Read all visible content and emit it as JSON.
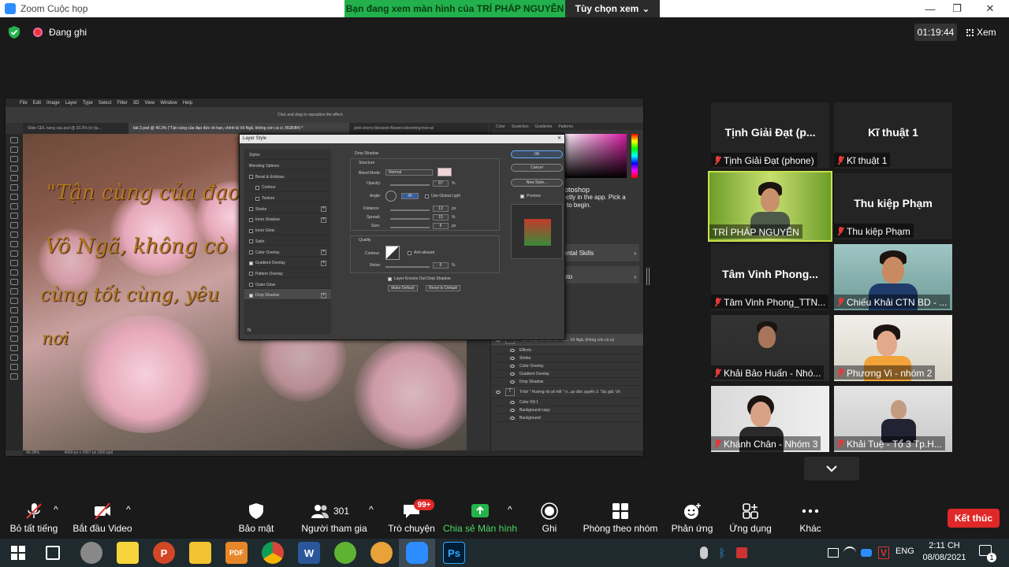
{
  "window": {
    "title": "Zoom Cuộc họp",
    "share_banner": "Bạn đang xem màn hình của TRÍ PHÁP NGUYỄN",
    "view_options": "Tùy chọn xem",
    "view_options_caret": "⌄",
    "minimize": "—",
    "maximize": "❐",
    "close": "✕"
  },
  "top": {
    "recording": "Đang ghi",
    "timer": "01:19:44",
    "view": "Xem"
  },
  "photoshop": {
    "menu": [
      "File",
      "Edit",
      "Image",
      "Layer",
      "Type",
      "Select",
      "Filter",
      "3D",
      "View",
      "Window",
      "Help"
    ],
    "options_hint": "Click and drag to reposition the effect.",
    "tabs": [
      "Slide CĐL nang cao.psd @ 33.3% (vi dụ...",
      "bài 2.psd @ 40.3% (\"Tận cùng của đạo đức vô hạn, chính là  Vô Ngã, không còn cá cì, RGB/8#) *",
      "pink-cherry-blossom-flowers-blooming-tree-wi"
    ],
    "canvas_text": [
      "\"Tận cùng của đạo",
      "Vô Ngã, không cò",
      "cùng tốt cùng, yêu",
      "nơi"
    ],
    "status": [
      "40.28%",
      "4000 px x 2667 px (300 ppi)"
    ],
    "panel_right": {
      "get_started": "hotoshop",
      "desc1": "rectly in the app. Pick a",
      "desc2": "w to begin.",
      "skills": "ental Skills",
      "photo": "oto",
      "panel_tabs": [
        "Color",
        "Swatches",
        "Gradients",
        "Patterns"
      ]
    },
    "layers": [
      {
        "name": "\"Tận cùng của đạo đức vô... Vô Ngã, không còn cá cà",
        "icon": "T"
      },
      {
        "name": "Effects",
        "icon": ""
      },
      {
        "name": "Stroke",
        "icon": ""
      },
      {
        "name": "Color Overlay",
        "icon": ""
      },
      {
        "name": "Gradient Overlay",
        "icon": ""
      },
      {
        "name": "Drop Shadow",
        "icon": ""
      },
      {
        "name": "Trích \" Hướng rồi sẽ hết \" n...ạo đức quyển 3. Tác giả: Vô",
        "icon": "T"
      },
      {
        "name": "Color Fill 1",
        "icon": ""
      },
      {
        "name": "Background copy",
        "icon": ""
      },
      {
        "name": "Background",
        "icon": ""
      }
    ],
    "dialog": {
      "title": "Layer Style",
      "close": "✕",
      "styles": [
        {
          "label": "Styles",
          "check": null,
          "plus": false
        },
        {
          "label": "Blending Options",
          "check": null,
          "plus": false
        },
        {
          "label": "Bevel & Emboss",
          "check": false,
          "plus": false
        },
        {
          "label": "Contour",
          "check": false,
          "plus": false
        },
        {
          "label": "Texture",
          "check": false,
          "plus": false
        },
        {
          "label": "Stroke",
          "check": false,
          "plus": true
        },
        {
          "label": "Inner Shadow",
          "check": false,
          "plus": true
        },
        {
          "label": "Inner Glow",
          "check": false,
          "plus": false
        },
        {
          "label": "Satin",
          "check": false,
          "plus": false
        },
        {
          "label": "Color Overlay",
          "check": false,
          "plus": true
        },
        {
          "label": "Gradient Overlay",
          "check": true,
          "plus": true
        },
        {
          "label": "Pattern Overlay",
          "check": false,
          "plus": false
        },
        {
          "label": "Outer Glow",
          "check": false,
          "plus": false
        },
        {
          "label": "Drop Shadow",
          "check": true,
          "plus": true
        }
      ],
      "fx_label": "fx",
      "section": "Drop Shadow",
      "structure": "Structure",
      "blend_mode_label": "Blend Mode:",
      "blend_mode": "Normal",
      "opacity_label": "Opacity:",
      "opacity": "67",
      "angle_label": "Angle:",
      "angle": "45",
      "global_light": "Use Global Light",
      "distance_label": "Distance:",
      "distance": "13",
      "spread_label": "Spread:",
      "spread": "15",
      "size_label": "Size:",
      "size": "6",
      "unit_pct": "%",
      "unit_px": "px",
      "quality": "Quality",
      "contour_label": "Contour:",
      "anti_aliased": "Anti-aliased",
      "noise_label": "Noise:",
      "noise": "0",
      "knockout": "Layer Knocks Out Drop Shadow",
      "make_default": "Make Default",
      "reset_default": "Reset to Default",
      "ok": "OK",
      "cancel": "Cancel",
      "new_style": "New Style...",
      "preview": "Preview"
    }
  },
  "participants": [
    {
      "big": "Tịnh Giải Đạt (p...",
      "name": "Tịnh Giải Đạt (phone)"
    },
    {
      "big": "Kĩ thuật 1",
      "name": "Kĩ thuật 1"
    },
    {
      "big": "",
      "name": "TRÍ PHÁP NGUYỄN"
    },
    {
      "big": "Thu kiệp Phạm",
      "name": "Thu kiệp Phạm"
    },
    {
      "big": "Tâm Vinh Phong...",
      "name": "Tâm Vinh Phong_TTN..."
    },
    {
      "big": "",
      "name": "Chiếu Khải CTN BD - ..."
    },
    {
      "big": "",
      "name": "Khải Bảo Huấn - Nhó..."
    },
    {
      "big": "",
      "name": "Phương Vi - nhóm 2"
    },
    {
      "big": "",
      "name": "Khánh Chân - Nhóm 3"
    },
    {
      "big": "",
      "name": "Khải Tuệ - Tổ 3 Tp.H..."
    }
  ],
  "toolbar": {
    "unmute_all": "Bỏ tất tiếng",
    "start_video": "Bắt đầu Video",
    "security": "Bảo mật",
    "participants": "Người tham gia",
    "participants_count": "301",
    "chat": "Trò chuyện",
    "chat_badge": "99+",
    "share": "Chia sẻ Màn hình",
    "record": "Ghi",
    "breakout": "Phòng theo nhóm",
    "reactions": "Phản ứng",
    "apps": "Ứng dụng",
    "more": "Khác",
    "end": "Kết thúc",
    "caret": "^"
  },
  "taskbar": {
    "lang": "ENG",
    "time": "2:11 CH",
    "date": "08/08/2021",
    "notif_count": "1",
    "apps": [
      "PowerPoint",
      "File Explorer",
      "PDF",
      "Chrome",
      "Word",
      "App",
      "App",
      "Zoom",
      "Photoshop"
    ],
    "ps_label": "Ps",
    "word_label": "W",
    "ppt_label": "P",
    "pdf_label": "PDF"
  }
}
